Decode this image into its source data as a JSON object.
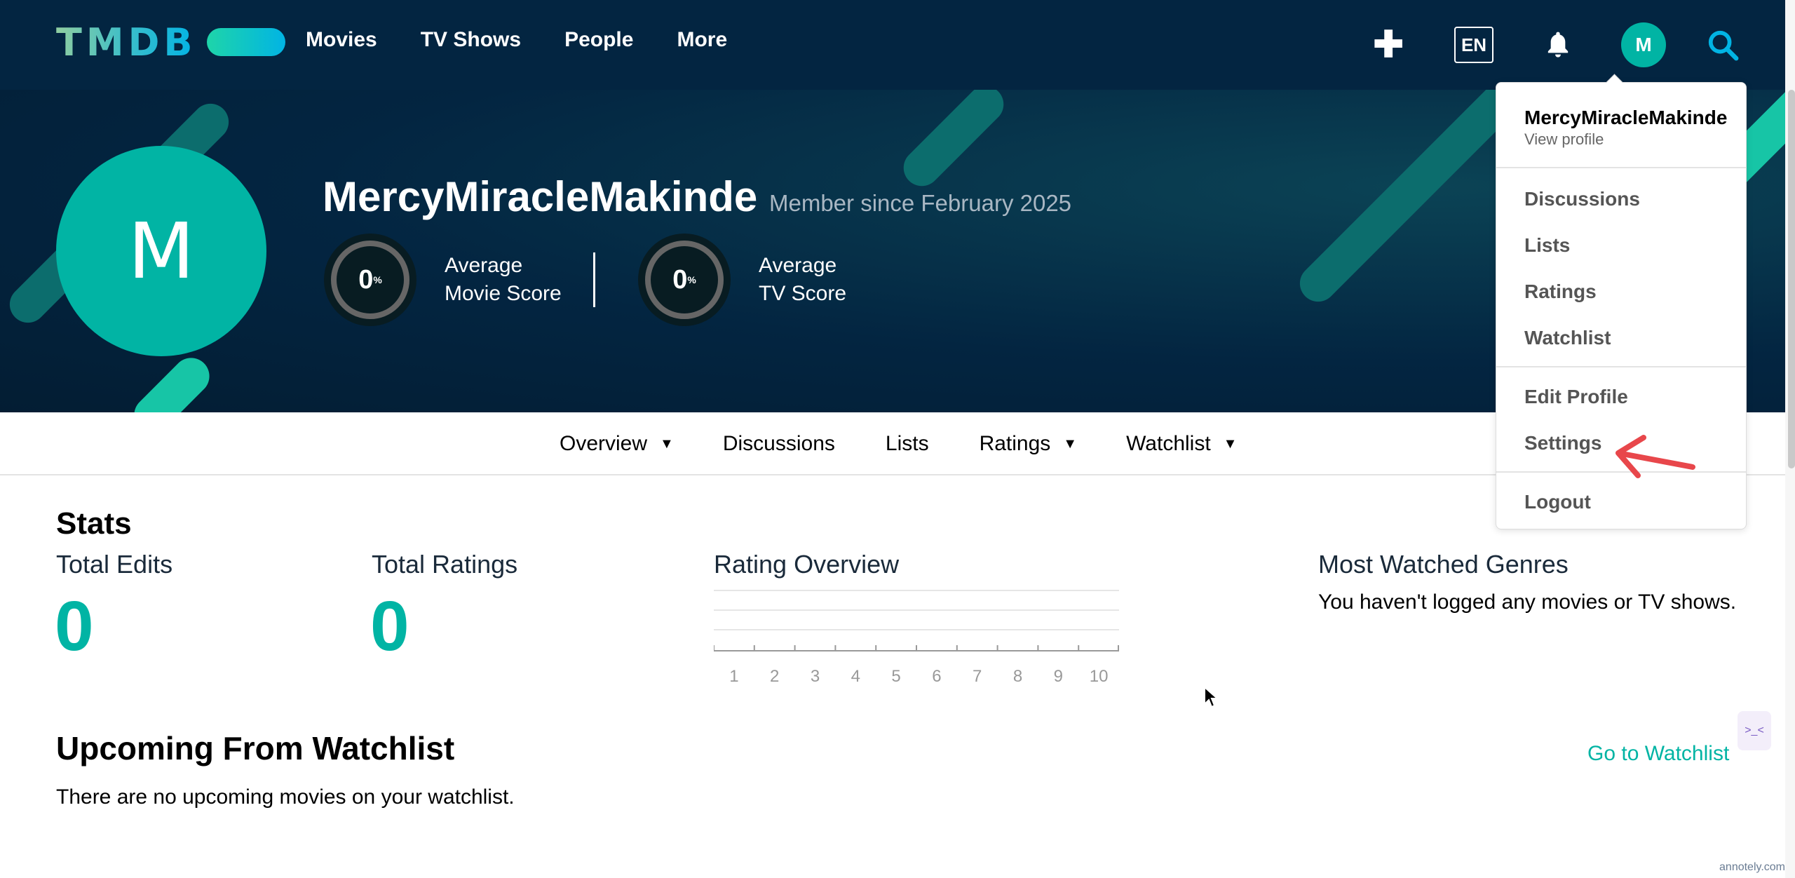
{
  "navbar": {
    "logo": "TMDB",
    "links": [
      "Movies",
      "TV Shows",
      "People",
      "More"
    ],
    "language": "EN",
    "avatar_initial": "M",
    "icons": [
      "plus-icon",
      "bell-icon",
      "search-icon"
    ]
  },
  "profile": {
    "avatar_initial": "M",
    "username": "MercyMiracleMakinde",
    "member_since": "Member since February 2025",
    "movie_score": {
      "value": "0",
      "unit": "%",
      "label_line1": "Average",
      "label_line2": "Movie Score"
    },
    "tv_score": {
      "value": "0",
      "unit": "%",
      "label_line1": "Average",
      "label_line2": "TV Score"
    }
  },
  "subnav": {
    "items": [
      {
        "label": "Overview",
        "has_dropdown": true
      },
      {
        "label": "Discussions",
        "has_dropdown": false
      },
      {
        "label": "Lists",
        "has_dropdown": false
      },
      {
        "label": "Ratings",
        "has_dropdown": true
      },
      {
        "label": "Watchlist",
        "has_dropdown": true
      }
    ]
  },
  "stats": {
    "heading": "Stats",
    "total_edits_label": "Total Edits",
    "total_edits_value": "0",
    "total_ratings_label": "Total Ratings",
    "total_ratings_value": "0",
    "rating_overview_label": "Rating Overview",
    "genres_label": "Most Watched Genres",
    "genres_empty": "You haven't logged any movies or TV shows."
  },
  "chart_data": {
    "type": "bar",
    "categories": [
      "1",
      "2",
      "3",
      "4",
      "5",
      "6",
      "7",
      "8",
      "9",
      "10"
    ],
    "values": [
      0,
      0,
      0,
      0,
      0,
      0,
      0,
      0,
      0,
      0
    ],
    "title": "Rating Overview",
    "xlabel": "",
    "ylabel": "",
    "grid": true
  },
  "upcoming": {
    "heading": "Upcoming From Watchlist",
    "link": "Go to Watchlist",
    "empty": "There are no upcoming movies on your watchlist."
  },
  "dropdown": {
    "username": "MercyMiracleMakinde",
    "view_profile": "View profile",
    "items_group1": [
      "Discussions",
      "Lists",
      "Ratings",
      "Watchlist"
    ],
    "items_group2": [
      "Edit Profile",
      "Settings"
    ],
    "logout": "Logout"
  },
  "colors": {
    "navy": "#032541",
    "teal": "#01b4a4",
    "annotation_arrow": "#e8474b"
  },
  "watermark": "annotely.com"
}
